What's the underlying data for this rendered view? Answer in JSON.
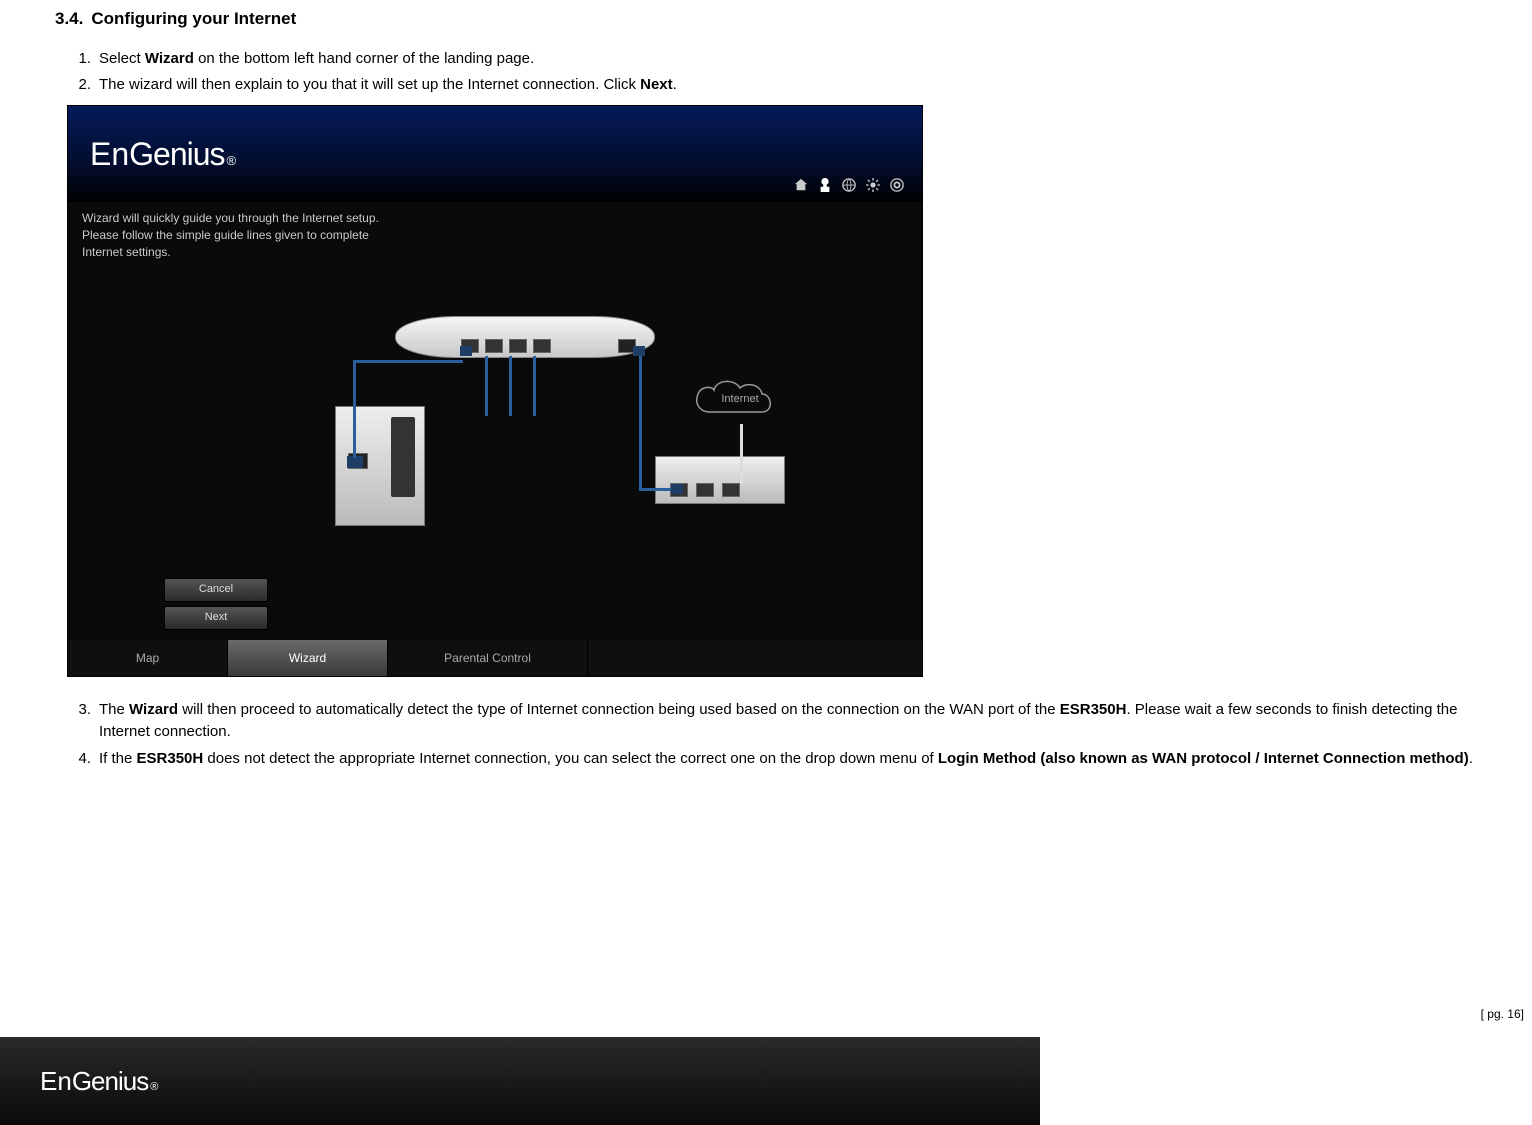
{
  "section": {
    "number": "3.4.",
    "title": "Configuring your Internet"
  },
  "steps": [
    {
      "pre": "Select ",
      "b1": "Wizard",
      "post": " on the bottom left hand corner of the landing page."
    },
    {
      "pre": "The wizard will then explain to you that it will set up the Internet connection. Click ",
      "b1": "Next",
      "post": "."
    }
  ],
  "screenshot": {
    "brand": {
      "en": "En",
      "genius": "Genius",
      "reg": "®"
    },
    "wizard_text": {
      "l1": "Wizard will quickly guide you through the Internet setup.",
      "l2": "Please follow the simple guide lines given to complete",
      "l3": "Internet settings."
    },
    "cloud_label": "Internet",
    "buttons": {
      "cancel": "Cancel",
      "next": "Next"
    },
    "nav": {
      "map": "Map",
      "wizard": "Wizard",
      "parental": "Parental Control"
    },
    "header_icons": [
      "home-icon",
      "network-icon",
      "globe-icon",
      "settings-icon",
      "help-icon"
    ]
  },
  "steps_lower": [
    {
      "parts": [
        {
          "t": "The "
        },
        {
          "b": "Wizard"
        },
        {
          "t": " will then proceed to automatically detect the type of Internet connection being used based on the connection on the WAN port of the "
        },
        {
          "b": "ESR350H"
        },
        {
          "t": ". Please wait a few seconds to finish detecting the Internet connection."
        }
      ]
    },
    {
      "parts": [
        {
          "t": "If the "
        },
        {
          "b": "ESR350H"
        },
        {
          "t": " does not detect the appropriate Internet connection, you can select the correct one on the drop down menu of "
        },
        {
          "b": "Login Method (also known as WAN protocol / Internet Connection method)"
        },
        {
          "t": "."
        }
      ]
    }
  ],
  "page_number": "[ pg. 16]",
  "footer_brand": {
    "en": "En",
    "genius": "Genius",
    "reg": "®"
  }
}
